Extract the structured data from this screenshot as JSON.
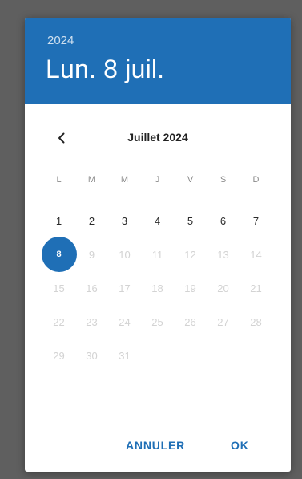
{
  "header": {
    "year": "2024",
    "selected_date": "Lun. 8 juil."
  },
  "calendar": {
    "month_title": "Juillet 2024",
    "weekdays": [
      "L",
      "M",
      "M",
      "J",
      "V",
      "S",
      "D"
    ],
    "days": [
      "1",
      "2",
      "3",
      "4",
      "5",
      "6",
      "7",
      "8",
      "9",
      "10",
      "11",
      "12",
      "13",
      "14",
      "15",
      "16",
      "17",
      "18",
      "19",
      "20",
      "21",
      "22",
      "23",
      "24",
      "25",
      "26",
      "27",
      "28",
      "29",
      "30",
      "31"
    ],
    "selected_day": "8",
    "enabled_days": [
      "1",
      "2",
      "3",
      "4",
      "5",
      "6",
      "7",
      "8"
    ]
  },
  "actions": {
    "cancel_label": "ANNULER",
    "ok_label": "OK"
  },
  "icons": {
    "previous_month": "chevron-left-icon"
  },
  "colors": {
    "accent": "#1f6fb6",
    "backdrop": "#5f5f5f",
    "enabled_day_text": "#2a2a2a",
    "disabled_day_text": "#d3d3d3"
  }
}
